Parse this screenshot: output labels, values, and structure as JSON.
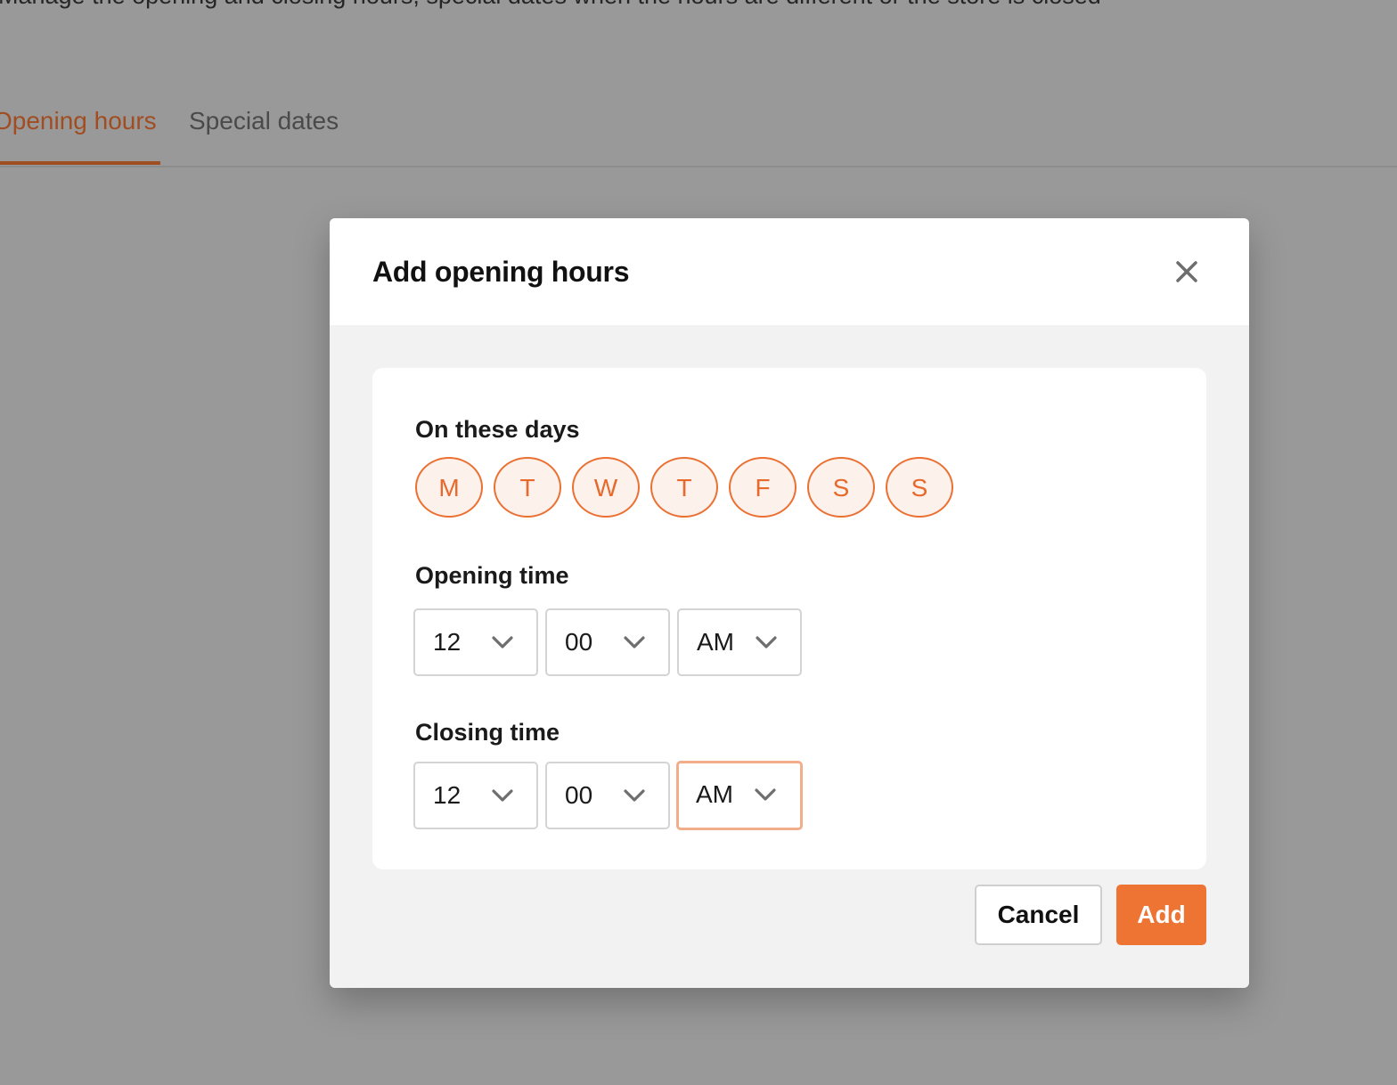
{
  "page": {
    "description": "Manage the opening and closing hours, special dates when the hours are different or the store is closed",
    "tabs": [
      {
        "label": "Opening hours",
        "active": true
      },
      {
        "label": "Special dates",
        "active": false
      }
    ]
  },
  "modal": {
    "title": "Add opening hours",
    "close_icon": "close-icon",
    "days_label": "On these days",
    "days": [
      "M",
      "T",
      "W",
      "T",
      "F",
      "S",
      "S"
    ],
    "opening_label": "Opening time",
    "opening": {
      "hour": "12",
      "minute": "00",
      "period": "AM"
    },
    "closing_label": "Closing time",
    "closing": {
      "hour": "12",
      "minute": "00",
      "period": "AM"
    },
    "cancel_label": "Cancel",
    "add_label": "Add"
  },
  "colors": {
    "accent": "#ee7433",
    "day_border": "#ea7034",
    "day_fill": "#fdf1eb",
    "focus_border": "#f2ae8a",
    "overlay": "#999999"
  }
}
